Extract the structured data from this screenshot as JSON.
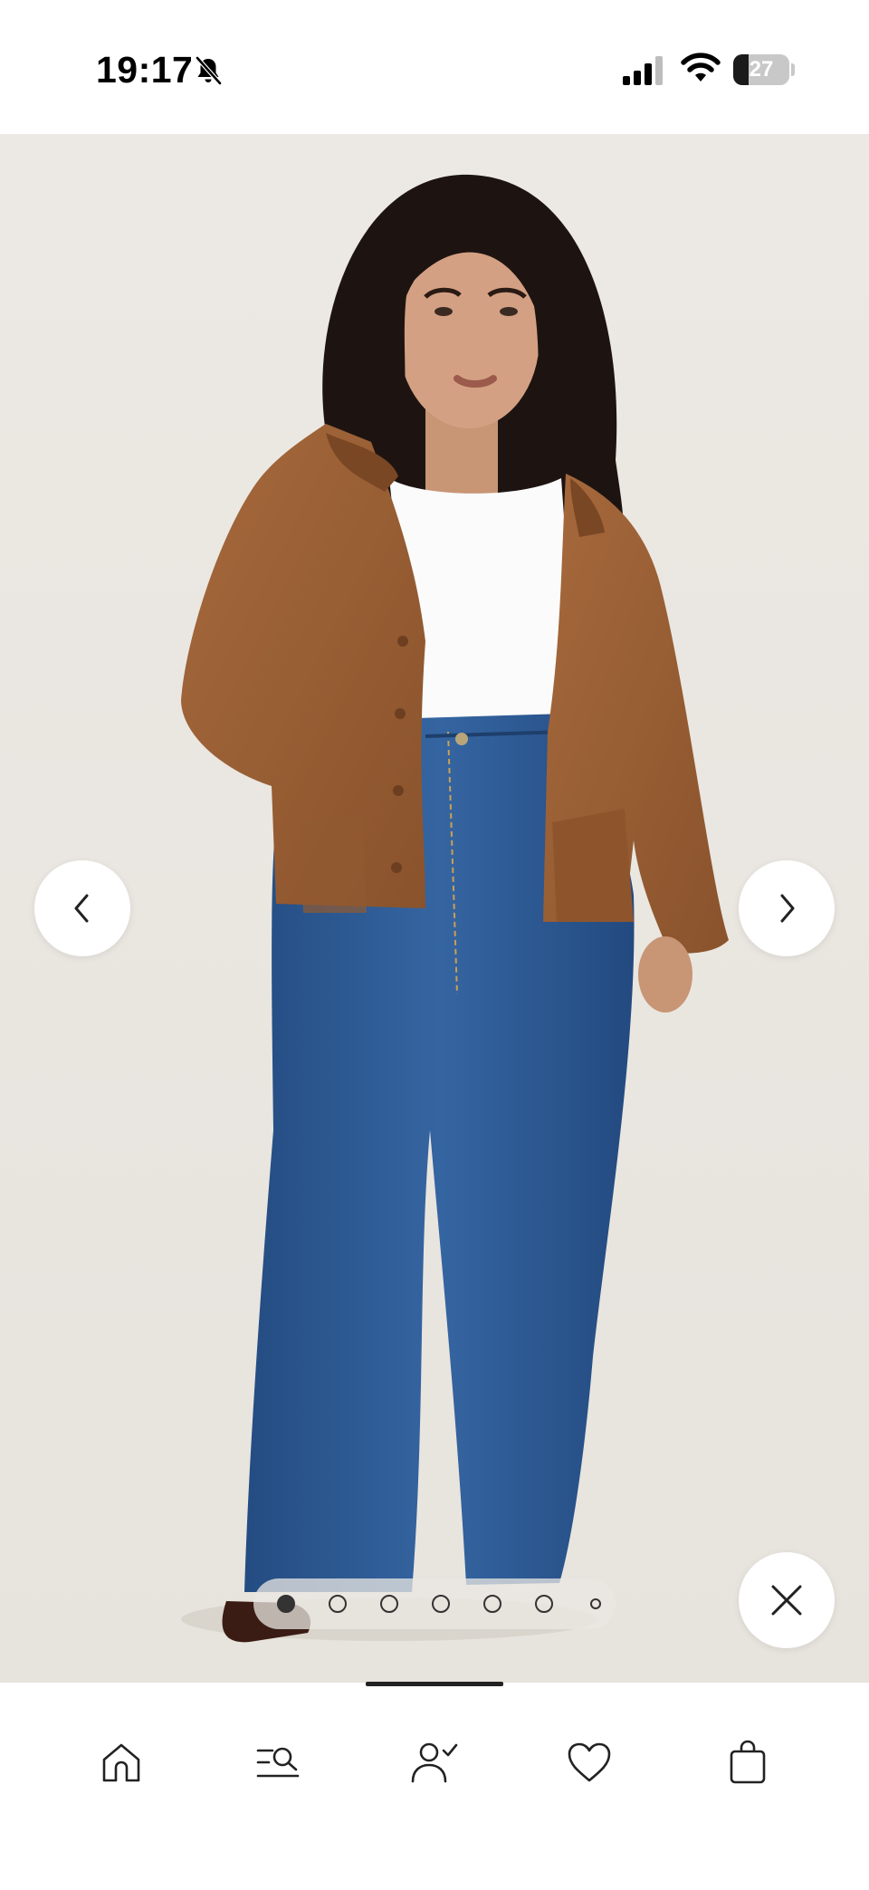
{
  "status_bar": {
    "time": "19:17",
    "battery": "27",
    "battery_level": 0.27,
    "icons": [
      "bell-slash-icon",
      "cellular-signal-icon",
      "wifi-icon",
      "battery-icon"
    ]
  },
  "gallery": {
    "image": "model-wearing-brown-suede-jacket-white-top-blue-wide-leg-jeans",
    "total_images": 7,
    "active_index": 0,
    "controls": [
      "chevron-left-icon",
      "chevron-right-icon",
      "close-icon"
    ]
  },
  "tab_bar": {
    "active_tab": "home",
    "tabs": [
      {
        "name": "home",
        "icon": "home-icon"
      },
      {
        "name": "search",
        "icon": "search-list-icon"
      },
      {
        "name": "account",
        "icon": "user-check-icon"
      },
      {
        "name": "wishlist",
        "icon": "heart-icon"
      },
      {
        "name": "bag",
        "icon": "shopping-bag-icon"
      }
    ]
  },
  "colors": {
    "background": "#ebe8e3",
    "jacket": "#9a5f36",
    "jeans": "#2f5a93",
    "icon": "#222222"
  }
}
